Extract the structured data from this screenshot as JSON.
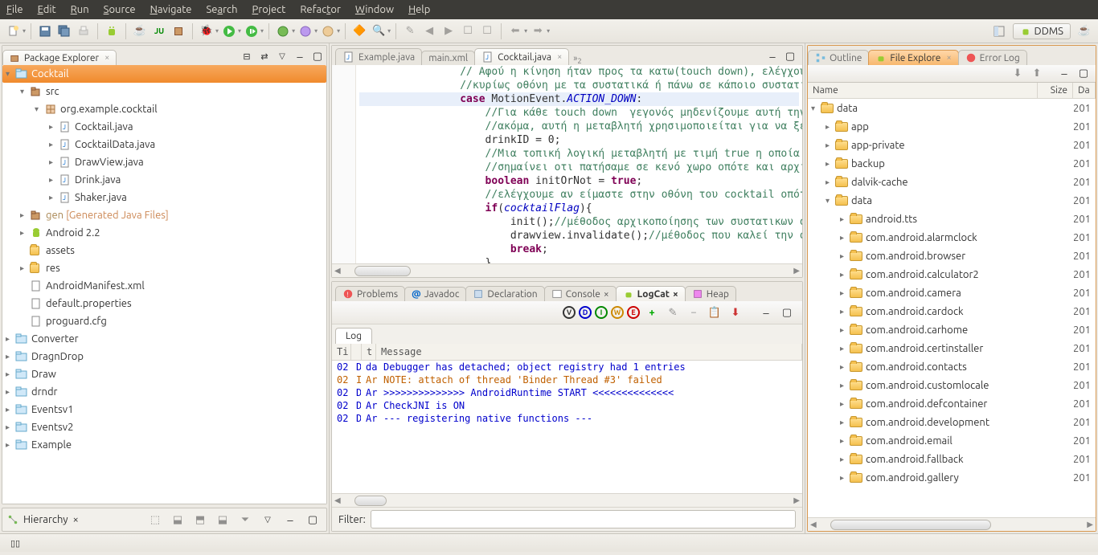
{
  "menubar": [
    "File",
    "Edit",
    "Run",
    "Source",
    "Navigate",
    "Search",
    "Project",
    "Refactor",
    "Window",
    "Help"
  ],
  "perspective": {
    "ddms": "DDMS"
  },
  "package_explorer": {
    "title": "Package Explorer",
    "tree": [
      {
        "d": 0,
        "tw": "▾",
        "icon": "proj",
        "label": "Cocktail",
        "sel": true
      },
      {
        "d": 1,
        "tw": "▾",
        "icon": "src",
        "label": "src"
      },
      {
        "d": 2,
        "tw": "▾",
        "icon": "pkg",
        "label": "org.example.cocktail"
      },
      {
        "d": 3,
        "tw": "▸",
        "icon": "ju",
        "label": "Cocktail.java"
      },
      {
        "d": 3,
        "tw": "▸",
        "icon": "ju",
        "label": "CocktailData.java"
      },
      {
        "d": 3,
        "tw": "▸",
        "icon": "ju",
        "label": "DrawView.java"
      },
      {
        "d": 3,
        "tw": "▸",
        "icon": "ju",
        "label": "Drink.java"
      },
      {
        "d": 3,
        "tw": "▸",
        "icon": "ju",
        "label": "Shaker.java"
      },
      {
        "d": 1,
        "tw": "▸",
        "icon": "src",
        "label": "gen [Generated Java Files]",
        "orange": true
      },
      {
        "d": 1,
        "tw": "▸",
        "icon": "and",
        "label": "Android 2.2"
      },
      {
        "d": 1,
        "tw": "",
        "icon": "fld",
        "label": "assets"
      },
      {
        "d": 1,
        "tw": "▸",
        "icon": "fld",
        "label": "res"
      },
      {
        "d": 1,
        "tw": "",
        "icon": "file",
        "label": "AndroidManifest.xml"
      },
      {
        "d": 1,
        "tw": "",
        "icon": "file",
        "label": "default.properties"
      },
      {
        "d": 1,
        "tw": "",
        "icon": "file",
        "label": "proguard.cfg"
      },
      {
        "d": 0,
        "tw": "▸",
        "icon": "proj",
        "label": "Converter"
      },
      {
        "d": 0,
        "tw": "▸",
        "icon": "proj",
        "label": "DragnDrop"
      },
      {
        "d": 0,
        "tw": "▸",
        "icon": "proj",
        "label": "Draw"
      },
      {
        "d": 0,
        "tw": "▸",
        "icon": "proj",
        "label": "drndr"
      },
      {
        "d": 0,
        "tw": "▸",
        "icon": "proj",
        "label": "Eventsv1"
      },
      {
        "d": 0,
        "tw": "▸",
        "icon": "proj",
        "label": "Eventsv2"
      },
      {
        "d": 0,
        "tw": "▸",
        "icon": "proj",
        "label": "Example"
      }
    ]
  },
  "hierarchy": {
    "title": "Hierarchy"
  },
  "editor_tabs": [
    {
      "label": "Example.java",
      "icon": "ju",
      "active": false
    },
    {
      "label": "main.xml",
      "icon": "xml",
      "active": false
    },
    {
      "label": "Cocktail.java",
      "icon": "ju",
      "active": true
    }
  ],
  "code_lines": [
    {
      "cls": "cm",
      "pre": "                ",
      "text": "// Αφού η κίνηση ήταν προς τα κατω(touch down), ελέγχουμε αν"
    },
    {
      "cls": "cm",
      "pre": "                ",
      "text": "//κυρίως οθόνη με τα συστατικά ή πάνω σε κάποιο συστατικό"
    },
    {
      "cls": "",
      "pre": "                ",
      "text": "<kw>case</kw> MotionEvent.<fld>ACTION_DOWN</fld>:",
      "hl": true
    },
    {
      "cls": "cm",
      "pre": "                    ",
      "text": "//Για κάθε touch down  γεγονός μηδενίζουμε αυτή την τι"
    },
    {
      "cls": "cm",
      "pre": "                    ",
      "text": "//ακόμα, αυτή η μεταβλητή χρησιμοποιείται για να ξεχωρ"
    },
    {
      "cls": "",
      "pre": "                    ",
      "text": "drinkID = 0;"
    },
    {
      "cls": "cm",
      "pre": "                    ",
      "text": "//Μια τοπική λογική μεταβλητή με τιμή true η οποία αν"
    },
    {
      "cls": "cm",
      "pre": "                    ",
      "text": "//σημαίνει οτι πατήσαμε σε κενό χωρο οπότε και αρχικοπ"
    },
    {
      "cls": "",
      "pre": "                    ",
      "text": "<kw>boolean</kw> initOrNot = <kw>true</kw>;"
    },
    {
      "cls": "cm",
      "pre": "                    ",
      "text": "//ελέγχουμε αν είμαστε στην οθόνη του cocktail οπότε α"
    },
    {
      "cls": "",
      "pre": "                    ",
      "text": "<kw>if</kw>(<fld>cocktailFlag</fld>){"
    },
    {
      "cls": "",
      "pre": "                        ",
      "text": "init();<cm>//μέθοδος αρχικοποίησης των συστατικων στην</cm>"
    },
    {
      "cls": "",
      "pre": "                        ",
      "text": "drawview.invalidate();<cm>//μέθοδος που καλεί την onDr</cm>"
    },
    {
      "cls": "",
      "pre": "                        ",
      "text": "<kw>break</kw>;"
    },
    {
      "cls": "",
      "pre": "                    ",
      "text": "}"
    }
  ],
  "bottom_view": {
    "tabs": [
      {
        "label": "Problems",
        "icon": "prob"
      },
      {
        "label": "Javadoc",
        "icon": "jdoc",
        "at": "@"
      },
      {
        "label": "Declaration",
        "icon": "decl"
      },
      {
        "label": "Console",
        "icon": "cons",
        "close": true
      },
      {
        "label": "LogCat",
        "icon": "and",
        "active": true,
        "close": true
      },
      {
        "label": "Heap",
        "icon": "heap"
      }
    ],
    "log_label": "Log",
    "columns": [
      "Ti",
      "",
      "t",
      "Message"
    ],
    "rows": [
      {
        "t": "02",
        "p": "D",
        "a": "da",
        "c": "d",
        "msg": "Debugger has detached; object registry had 1 entries"
      },
      {
        "t": "02",
        "p": "I",
        "a": "Ar",
        "c": "w",
        "msg": "NOTE: attach of thread 'Binder Thread #3' failed"
      },
      {
        "t": "02",
        "p": "D",
        "a": "Ar",
        "c": "d",
        "msg": ">>>>>>>>>>>>>> AndroidRuntime START <<<<<<<<<<<<<<"
      },
      {
        "t": "02",
        "p": "D",
        "a": "Ar",
        "c": "d",
        "msg": "CheckJNI is ON"
      },
      {
        "t": "02",
        "p": "D",
        "a": "Ar",
        "c": "d",
        "msg": "--- registering native functions ---"
      }
    ],
    "filter_label": "Filter:"
  },
  "right_panel": {
    "tabs": [
      {
        "label": "Outline",
        "icon": "outline"
      },
      {
        "label": "File Explore",
        "icon": "and",
        "active": true,
        "close": true
      },
      {
        "label": "Error Log",
        "icon": "err"
      }
    ],
    "columns": [
      "Name",
      "Size",
      "Da"
    ],
    "tree": [
      {
        "d": 0,
        "tw": "▾",
        "label": "data",
        "date": "201"
      },
      {
        "d": 1,
        "tw": "▸",
        "label": "app",
        "date": "201"
      },
      {
        "d": 1,
        "tw": "▸",
        "label": "app-private",
        "date": "201"
      },
      {
        "d": 1,
        "tw": "▸",
        "label": "backup",
        "date": "201"
      },
      {
        "d": 1,
        "tw": "▸",
        "label": "dalvik-cache",
        "date": "201"
      },
      {
        "d": 1,
        "tw": "▾",
        "label": "data",
        "date": "201"
      },
      {
        "d": 2,
        "tw": "▸",
        "label": "android.tts",
        "date": "201"
      },
      {
        "d": 2,
        "tw": "▸",
        "label": "com.android.alarmclock",
        "date": "201"
      },
      {
        "d": 2,
        "tw": "▸",
        "label": "com.android.browser",
        "date": "201"
      },
      {
        "d": 2,
        "tw": "▸",
        "label": "com.android.calculator2",
        "date": "201"
      },
      {
        "d": 2,
        "tw": "▸",
        "label": "com.android.camera",
        "date": "201"
      },
      {
        "d": 2,
        "tw": "▸",
        "label": "com.android.cardock",
        "date": "201"
      },
      {
        "d": 2,
        "tw": "▸",
        "label": "com.android.carhome",
        "date": "201"
      },
      {
        "d": 2,
        "tw": "▸",
        "label": "com.android.certinstaller",
        "date": "201"
      },
      {
        "d": 2,
        "tw": "▸",
        "label": "com.android.contacts",
        "date": "201"
      },
      {
        "d": 2,
        "tw": "▸",
        "label": "com.android.customlocale",
        "date": "201"
      },
      {
        "d": 2,
        "tw": "▸",
        "label": "com.android.defcontainer",
        "date": "201"
      },
      {
        "d": 2,
        "tw": "▸",
        "label": "com.android.development",
        "date": "201"
      },
      {
        "d": 2,
        "tw": "▸",
        "label": "com.android.email",
        "date": "201"
      },
      {
        "d": 2,
        "tw": "▸",
        "label": "com.android.fallback",
        "date": "201"
      },
      {
        "d": 2,
        "tw": "▸",
        "label": "com.android.gallery",
        "date": "201"
      }
    ]
  }
}
